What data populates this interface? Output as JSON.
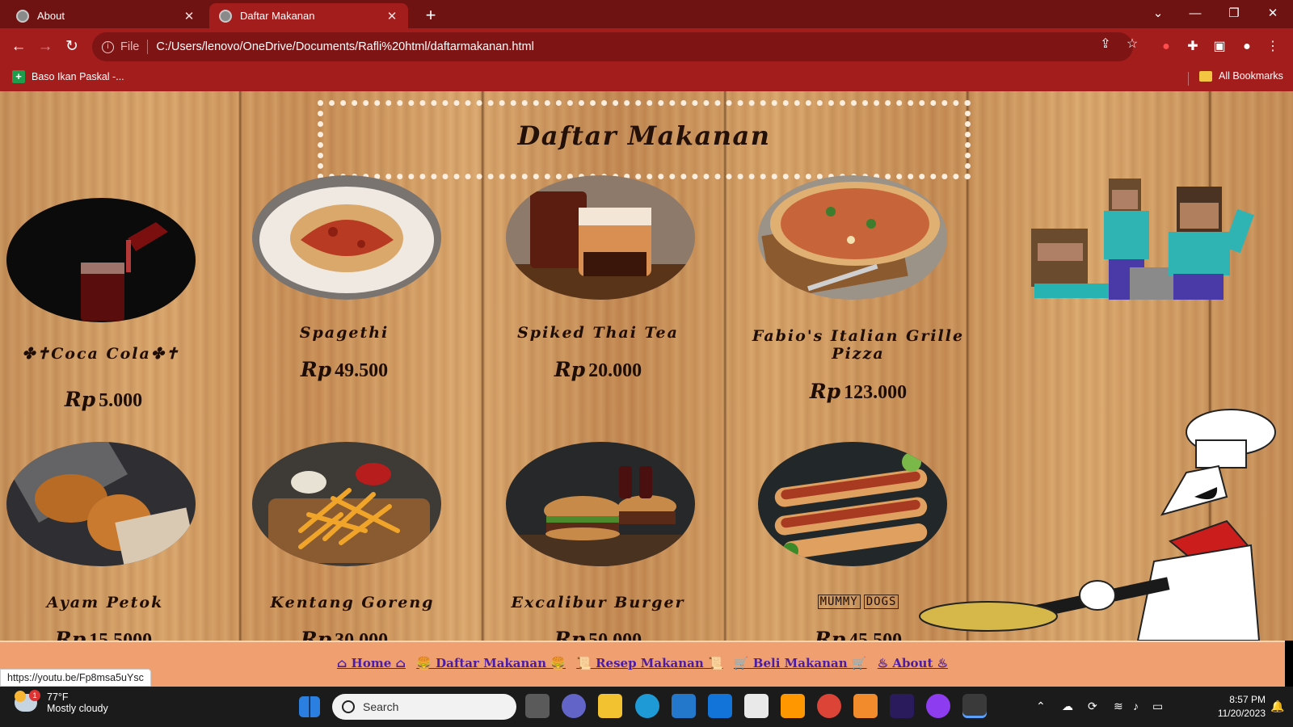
{
  "browser": {
    "tabs": [
      {
        "title": "About",
        "active": false
      },
      {
        "title": "Daftar Makanan",
        "active": true
      }
    ],
    "address": {
      "scheme": "File",
      "url": "C:/Users/lenovo/OneDrive/Documents/Rafli%20html/daftarmakanan.html"
    },
    "bookmarks": [
      {
        "label": "Baso Ikan Paskal -..."
      }
    ],
    "all_bookmarks": "All Bookmarks"
  },
  "page": {
    "title": "Daftar Makanan",
    "currency": "Rp",
    "items": [
      {
        "name": "Coca Cola",
        "decor_left": "✤✝",
        "decor_right": "✤✝",
        "price": "5.000"
      },
      {
        "name": "Spagethi",
        "price": "49.500"
      },
      {
        "name": "Spiked Thai Tea",
        "price": "20.000"
      },
      {
        "name": "Fabio's Italian Grille Pizza",
        "price": "123.000"
      },
      {
        "name": "Ayam Petok",
        "price": "15.5000"
      },
      {
        "name": "Kentang Goreng",
        "price": "30.000"
      },
      {
        "name": "Excalibur Burger",
        "price": "50.000"
      },
      {
        "name_parts": [
          "MUMMY",
          "DOGS"
        ],
        "price": "45.500"
      }
    ]
  },
  "footer_nav": [
    {
      "label": "⌂ Home ⌂"
    },
    {
      "label": "🍔 Daftar Makanan 🍔"
    },
    {
      "label": "📜 Resep Makanan 📜"
    },
    {
      "label": "🛒 Beli Makanan 🛒"
    },
    {
      "label": "♨ About ♨"
    }
  ],
  "status_url": "https://youtu.be/Fp8msa5uYsc",
  "taskbar": {
    "weather_temp": "77°F",
    "weather_desc": "Mostly cloudy",
    "weather_badge": "1",
    "search_placeholder": "Search",
    "time": "8:57 PM",
    "date": "11/20/2023"
  },
  "colors": {
    "chrome_dark": "#6e1212",
    "chrome": "#a41d1d",
    "footer_bg": "#f0a070",
    "link": "#4a1ca8"
  }
}
